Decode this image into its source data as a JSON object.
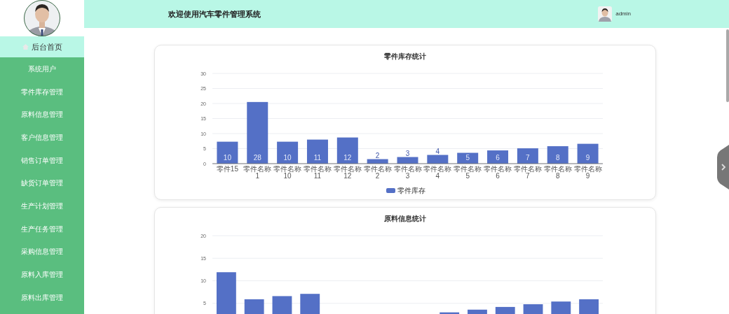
{
  "sidebar": {
    "items": [
      {
        "label": "后台首页",
        "kind": "home",
        "selected": true
      },
      {
        "label": "系统用户",
        "kind": "link",
        "selected": false
      },
      {
        "label": "零件库存管理",
        "kind": "link",
        "selected": false
      },
      {
        "label": "原料信息管理",
        "kind": "link",
        "selected": false
      },
      {
        "label": "客户信息管理",
        "kind": "link",
        "selected": false
      },
      {
        "label": "销售订单管理",
        "kind": "link",
        "selected": false
      },
      {
        "label": "缺货订单管理",
        "kind": "link",
        "selected": false
      },
      {
        "label": "生产计划管理",
        "kind": "link",
        "selected": false
      },
      {
        "label": "生产任务管理",
        "kind": "link",
        "selected": false
      },
      {
        "label": "采购信息管理",
        "kind": "link",
        "selected": false
      },
      {
        "label": "原料入库管理",
        "kind": "link",
        "selected": false
      },
      {
        "label": "原料出库管理",
        "kind": "link",
        "selected": false
      }
    ]
  },
  "header": {
    "title": "欢迎使用汽车零件管理系统",
    "user": "admin"
  },
  "cards": [
    {
      "chart_data": {
        "type": "bar",
        "title": "零件库存统计",
        "categories": [
          "零件15",
          "零件名称\n1",
          "零件名称\n10",
          "零件名称\n11",
          "零件名称\n12",
          "零件名称\n2",
          "零件名称\n3",
          "零件名称\n4",
          "零件名称\n5",
          "零件名称\n6",
          "零件名称\n7",
          "零件名称\n8",
          "零件名称\n9"
        ],
        "series": [
          {
            "name": "零件库存",
            "color": "#5470c6",
            "values": [
              7.3,
              20.5,
              7.3,
              8,
              8.7,
              1.5,
              2.2,
              2.9,
              3.6,
              4.4,
              5.1,
              5.8,
              6.6
            ]
          }
        ],
        "ylim": [
          0,
          30
        ],
        "yticks": [
          0,
          5,
          10,
          15,
          20,
          25,
          30
        ],
        "grid": true,
        "value_labels": [
          "10",
          "28",
          "10",
          "11",
          "12",
          "2",
          "3",
          "4",
          "5",
          "6",
          "7",
          "8",
          "9"
        ]
      }
    },
    {
      "chart_data": {
        "type": "bar",
        "title": "原料信息统计",
        "series": [
          {
            "values": [
              11.9,
              5.9,
              6.6,
              7.1,
              null,
              null,
              null,
              null,
              3,
              3.6,
              4.2,
              4.8,
              5.4,
              5.9
            ]
          }
        ],
        "ylim": [
          0,
          20
        ],
        "grid": true,
        "yticks": [
          5,
          10,
          15,
          20
        ]
      }
    }
  ]
}
